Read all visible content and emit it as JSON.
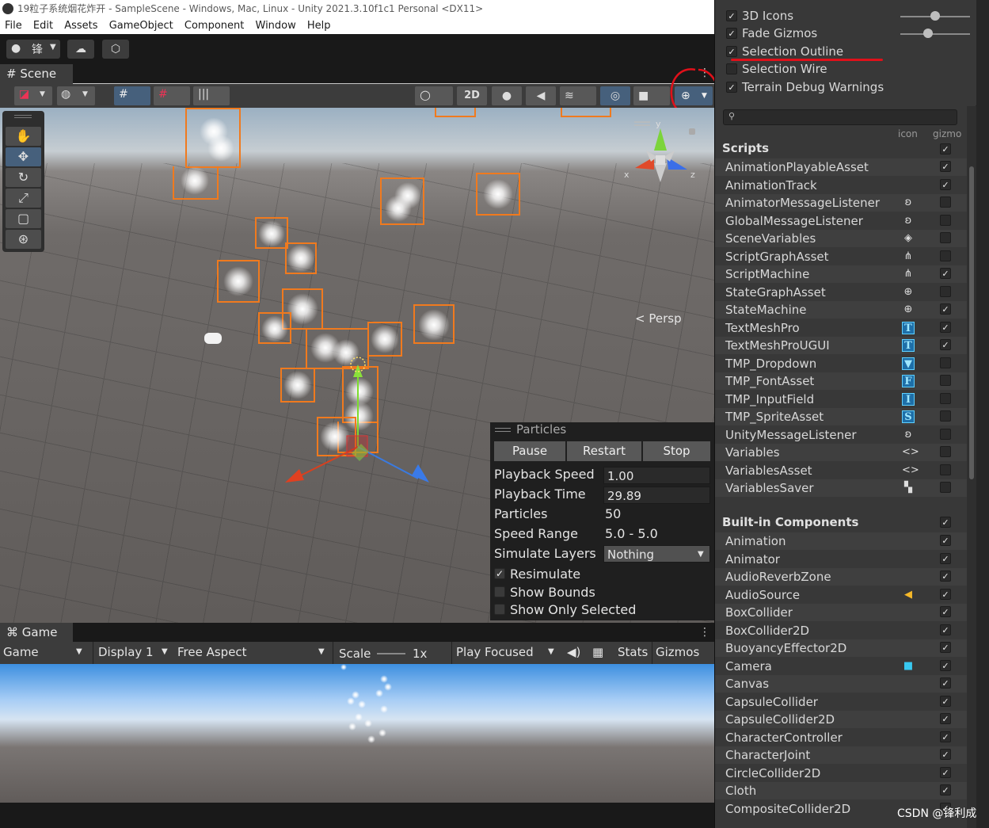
{
  "titlebar": {
    "text": "19粒子系统烟花炸开 - SampleScene - Windows, Mac, Linux - Unity 2021.3.10f1c1 Personal <DX11>"
  },
  "menu": [
    "File",
    "Edit",
    "Assets",
    "GameObject",
    "Component",
    "Window",
    "Help"
  ],
  "toolbar": {
    "account": "锋"
  },
  "scene": {
    "tab": "Scene",
    "two_d": "2D",
    "persp": "Persp",
    "axis_y": "y",
    "axis_x": "x",
    "axis_z": "z"
  },
  "particles": {
    "title": "Particles",
    "buttons": [
      "Pause",
      "Restart",
      "Stop"
    ],
    "playback_speed_label": "Playback Speed",
    "playback_speed": "1.00",
    "playback_time_label": "Playback Time",
    "playback_time": "29.89",
    "particles_label": "Particles",
    "particles_count": "50",
    "speed_range_label": "Speed Range",
    "speed_range": "5.0 - 5.0",
    "simulate_layers_label": "Simulate Layers",
    "simulate_layers": "Nothing",
    "resimulate": "Resimulate",
    "show_bounds": "Show Bounds",
    "show_only_selected": "Show Only Selected"
  },
  "game": {
    "tab": "Game",
    "view_mode": "Game",
    "display": "Display 1",
    "aspect": "Free Aspect",
    "scale_label": "Scale",
    "scale_value": "1x",
    "play_mode": "Play Focused",
    "stats": "Stats",
    "gizmos": "Gizmos"
  },
  "gizmos_menu": {
    "options": [
      {
        "label": "3D Icons",
        "checked": true
      },
      {
        "label": "Fade Gizmos",
        "checked": true
      },
      {
        "label": "Selection Outline",
        "checked": true
      },
      {
        "label": "Selection Wire",
        "checked": false
      },
      {
        "label": "Terrain Debug Warnings",
        "checked": true
      }
    ],
    "col_icon": "icon",
    "col_gizmo": "gizmo",
    "scripts_header": "Scripts",
    "scripts": [
      {
        "name": "AnimationPlayableAsset",
        "icon": "",
        "checked": true
      },
      {
        "name": "AnimationTrack",
        "icon": "",
        "checked": true
      },
      {
        "name": "AnimatorMessageListener",
        "icon": "ear-icon",
        "checked": false
      },
      {
        "name": "GlobalMessageListener",
        "icon": "ear-icon",
        "checked": false
      },
      {
        "name": "SceneVariables",
        "icon": "scene-var-icon",
        "checked": false
      },
      {
        "name": "ScriptGraphAsset",
        "icon": "graph-icon",
        "checked": false
      },
      {
        "name": "ScriptMachine",
        "icon": "graph-icon",
        "checked": true
      },
      {
        "name": "StateGraphAsset",
        "icon": "state-icon",
        "checked": false
      },
      {
        "name": "StateMachine",
        "icon": "state-icon",
        "checked": true
      },
      {
        "name": "TextMeshPro",
        "icon": "T",
        "checked": true
      },
      {
        "name": "TextMeshProUGUI",
        "icon": "T",
        "checked": true
      },
      {
        "name": "TMP_Dropdown",
        "icon": "▼",
        "checked": false
      },
      {
        "name": "TMP_FontAsset",
        "icon": "F",
        "checked": false
      },
      {
        "name": "TMP_InputField",
        "icon": "I",
        "checked": false
      },
      {
        "name": "TMP_SpriteAsset",
        "icon": "S",
        "checked": false
      },
      {
        "name": "UnityMessageListener",
        "icon": "ear-icon",
        "checked": false
      },
      {
        "name": "Variables",
        "icon": "code-icon",
        "checked": false
      },
      {
        "name": "VariablesAsset",
        "icon": "code-icon",
        "checked": false
      },
      {
        "name": "VariablesSaver",
        "icon": "saver-icon",
        "checked": false
      }
    ],
    "builtin_header": "Built-in Components",
    "builtin": [
      {
        "name": "Animation",
        "icon": "",
        "checked": true
      },
      {
        "name": "Animator",
        "icon": "",
        "checked": true
      },
      {
        "name": "AudioReverbZone",
        "icon": "",
        "checked": true
      },
      {
        "name": "AudioSource",
        "icon": "speaker-icon",
        "checked": true
      },
      {
        "name": "BoxCollider",
        "icon": "",
        "checked": true
      },
      {
        "name": "BoxCollider2D",
        "icon": "",
        "checked": true
      },
      {
        "name": "BuoyancyEffector2D",
        "icon": "",
        "checked": true
      },
      {
        "name": "Camera",
        "icon": "camera-icon",
        "checked": true
      },
      {
        "name": "Canvas",
        "icon": "",
        "checked": true
      },
      {
        "name": "CapsuleCollider",
        "icon": "",
        "checked": true
      },
      {
        "name": "CapsuleCollider2D",
        "icon": "",
        "checked": true
      },
      {
        "name": "CharacterController",
        "icon": "",
        "checked": true
      },
      {
        "name": "CharacterJoint",
        "icon": "",
        "checked": true
      },
      {
        "name": "CircleCollider2D",
        "icon": "",
        "checked": true
      },
      {
        "name": "Cloth",
        "icon": "",
        "checked": true
      },
      {
        "name": "CompositeCollider2D",
        "icon": "",
        "checked": true
      }
    ]
  },
  "watermark": "CSDN @锋利成",
  "colors": {
    "selection_outline": "#f07a1e",
    "annotation_red": "#e0101a",
    "accent_blue": "#46607c"
  }
}
